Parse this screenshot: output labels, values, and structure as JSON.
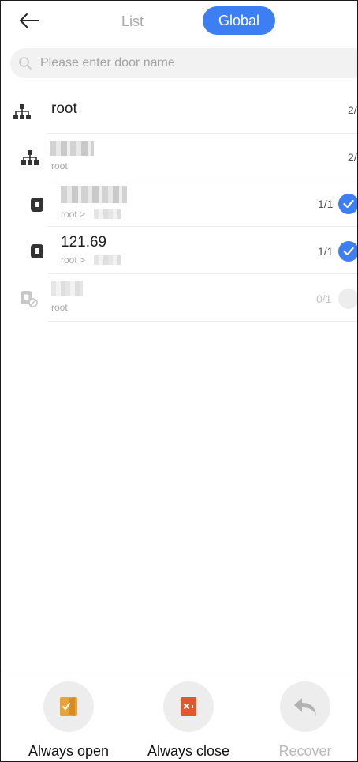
{
  "header": {
    "tabs": [
      {
        "label": "List"
      },
      {
        "label": "Global"
      }
    ]
  },
  "search": {
    "placeholder": "Please enter door name"
  },
  "tree": {
    "root": {
      "name": "root",
      "count": "2/"
    },
    "group": {
      "path": "root",
      "count": "2/"
    },
    "doors": [
      {
        "path": "root >",
        "count": "1/1",
        "checked": true
      },
      {
        "name": "121.69",
        "path": "root >",
        "count": "1/1",
        "checked": true
      },
      {
        "path": "root",
        "count": "0/1",
        "checked": false
      }
    ]
  },
  "actions": [
    {
      "label": "Always open",
      "icon": "door-open-icon",
      "color": "#e8a33a"
    },
    {
      "label": "Always close",
      "icon": "door-close-icon",
      "color": "#e2572e"
    },
    {
      "label": "Recover",
      "icon": "undo-icon",
      "disabled": true
    }
  ],
  "colors": {
    "accent": "#3d7ff3"
  }
}
